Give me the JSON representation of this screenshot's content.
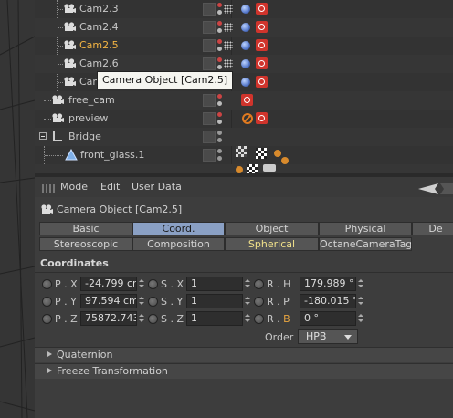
{
  "objects": [
    {
      "name": "Cam2.3",
      "selected": false
    },
    {
      "name": "Cam2.4",
      "selected": false
    },
    {
      "name": "Cam2.5",
      "selected": true
    },
    {
      "name": "Cam2.6",
      "selected": false
    },
    {
      "name": "Cam",
      "selected": false
    },
    {
      "name": "free_cam",
      "selected": false
    },
    {
      "name": "preview",
      "selected": false
    },
    {
      "name": "Bridge",
      "selected": false
    },
    {
      "name": "front_glass.1",
      "selected": false
    }
  ],
  "tooltip": "Camera Object [Cam2.5]",
  "menu": {
    "mode": "Mode",
    "edit": "Edit",
    "user_data": "User Data"
  },
  "object_title": "Camera Object [Cam2.5]",
  "tabs_row1": [
    "Basic",
    "Coord.",
    "Object",
    "Physical",
    "De"
  ],
  "tabs_row2": [
    "Stereoscopic",
    "Composition",
    "Spherical",
    "OctaneCameraTag"
  ],
  "active_tab": "Coord.",
  "coordinates": {
    "header": "Coordinates",
    "px": {
      "label": "P . X",
      "value": "-24.799 cr"
    },
    "py": {
      "label": "P . Y",
      "value": "97.594 cm"
    },
    "pz": {
      "label": "P . Z",
      "value": "75872.743"
    },
    "sx": {
      "label": "S . X",
      "value": "1"
    },
    "sy": {
      "label": "S . Y",
      "value": "1"
    },
    "sz": {
      "label": "S . Z",
      "value": "1"
    },
    "rh": {
      "label": "R . H",
      "value": "179.989 °"
    },
    "rp": {
      "label": "R . P",
      "value": "-180.015 °"
    },
    "rb_prefix": "R . ",
    "rb_suffix": "B",
    "rb_value": "0 °"
  },
  "order": {
    "label": "Order",
    "value": "HPB"
  },
  "sections": {
    "quaternion": "Quaternion",
    "freeze": "Freeze Transformation"
  },
  "colors": {
    "selected_text": "#f3b443",
    "active_tab": "#8aa0c4",
    "tag_red": "#d0342c"
  }
}
